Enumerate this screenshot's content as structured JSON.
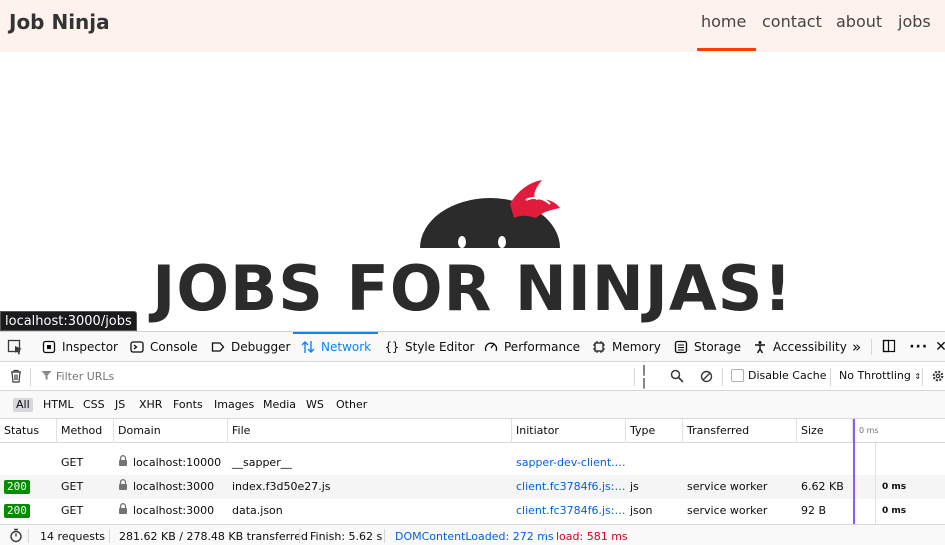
{
  "site": {
    "brand": "Job Ninja",
    "nav": [
      {
        "label": "home",
        "active": true
      },
      {
        "label": "contact",
        "active": false
      },
      {
        "label": "about",
        "active": false
      },
      {
        "label": "jobs",
        "active": false
      }
    ],
    "accent_color": "#ff3e00",
    "hero_title": "JOBS FOR NINJAS!"
  },
  "url_tooltip": "localhost:3000/jobs",
  "devtools": {
    "tabs": [
      {
        "label": "Inspector",
        "icon": "inspector-icon"
      },
      {
        "label": "Console",
        "icon": "console-icon"
      },
      {
        "label": "Debugger",
        "icon": "debugger-icon"
      },
      {
        "label": "Network",
        "icon": "network-icon",
        "active": true
      },
      {
        "label": "Style Editor",
        "icon": "style-editor-icon"
      },
      {
        "label": "Performance",
        "icon": "performance-icon"
      },
      {
        "label": "Memory",
        "icon": "memory-icon"
      },
      {
        "label": "Storage",
        "icon": "storage-icon"
      },
      {
        "label": "Accessibility",
        "icon": "accessibility-icon"
      }
    ],
    "toolbar": {
      "filter_placeholder": "Filter URLs",
      "disable_cache_label": "Disable Cache",
      "throttling_label": "No Throttling"
    },
    "type_filters": [
      "All",
      "HTML",
      "CSS",
      "JS",
      "XHR",
      "Fonts",
      "Images",
      "Media",
      "WS",
      "Other"
    ],
    "columns": [
      "Status",
      "Method",
      "Domain",
      "File",
      "Initiator",
      "Type",
      "Transferred",
      "Size"
    ],
    "waterfall_header": "0 ms",
    "rows": [
      {
        "status": "",
        "method": "GET",
        "domain": "localhost:10000",
        "file": "__sapper__",
        "initiator": "sapper-dev-client.1...",
        "type": "",
        "transferred": "",
        "size": "",
        "time": ""
      },
      {
        "status": "200",
        "method": "GET",
        "domain": "localhost:3000",
        "file": "index.f3d50e27.js",
        "initiator": "client.fc3784f6.js:17...",
        "type": "js",
        "transferred": "service worker",
        "size": "6.62 KB",
        "time": "0 ms"
      },
      {
        "status": "200",
        "method": "GET",
        "domain": "localhost:3000",
        "file": "data.json",
        "initiator": "client.fc3784f6.js:22...",
        "type": "json",
        "transferred": "service worker",
        "size": "92 B",
        "time": "0 ms"
      }
    ],
    "statusbar": {
      "requests": "14 requests",
      "size": "281.62 KB / 278.48 KB transferred",
      "finish": "Finish: 5.62 s",
      "domcontentloaded": "DOMContentLoaded: 272 ms",
      "load": "load: 581 ms"
    },
    "colors": {
      "active_tab": "#0a84ff",
      "status_ok": "#058b00",
      "link": "#0060df",
      "domcontentloaded": "#0060df",
      "load": "#d70022"
    }
  }
}
